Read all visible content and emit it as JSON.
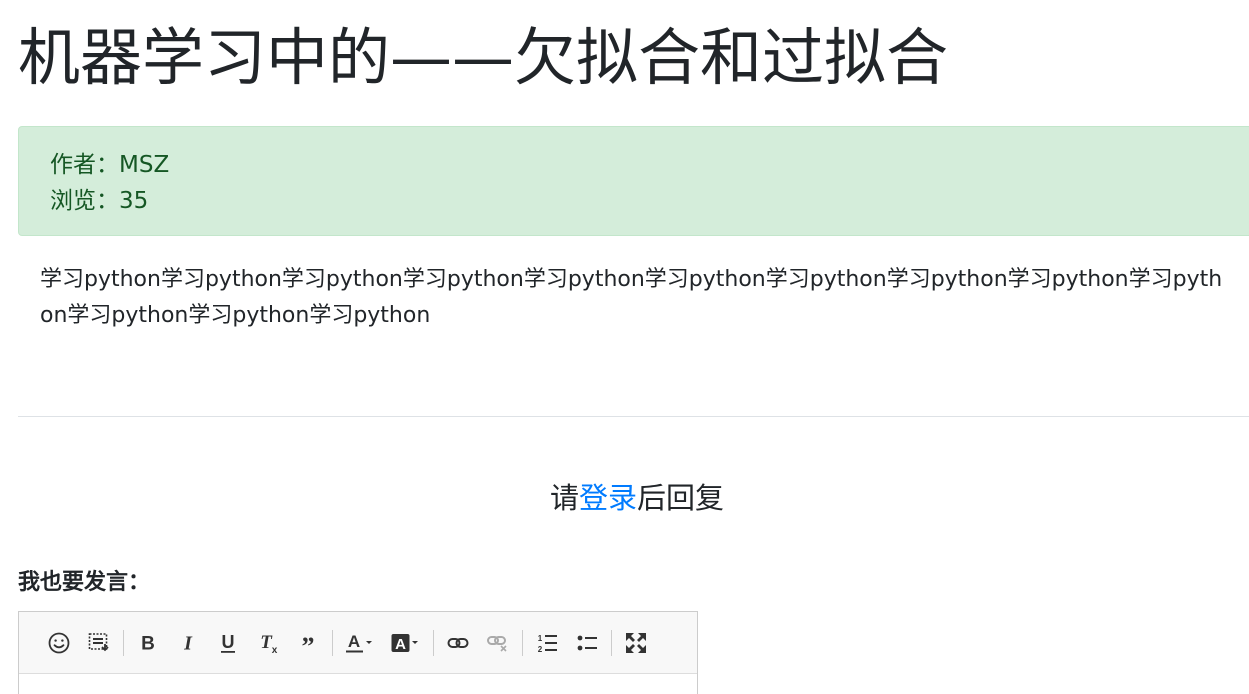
{
  "article": {
    "title": "机器学习中的——欠拟合和过拟合",
    "author_line": "作者：MSZ",
    "views_line": "浏览：35",
    "body": "学习python学习python学习python学习python学习python学习python学习python学习python学习python学习python学习python学习python学习python"
  },
  "reply": {
    "prefix": "请",
    "login_link": "登录",
    "suffix": "后回复"
  },
  "comment": {
    "label": "我也要发言："
  },
  "editor": {
    "toolbar_icons": [
      "emoji-icon",
      "image-upload-icon",
      "bold-icon",
      "italic-icon",
      "underline-icon",
      "clear-format-icon",
      "quote-icon",
      "font-color-icon",
      "background-color-icon",
      "link-icon",
      "unlink-icon",
      "ordered-list-icon",
      "unordered-list-icon",
      "fullscreen-icon"
    ]
  },
  "colors": {
    "alert_bg": "#d4edda",
    "alert_text": "#155724",
    "link": "#007bff"
  }
}
